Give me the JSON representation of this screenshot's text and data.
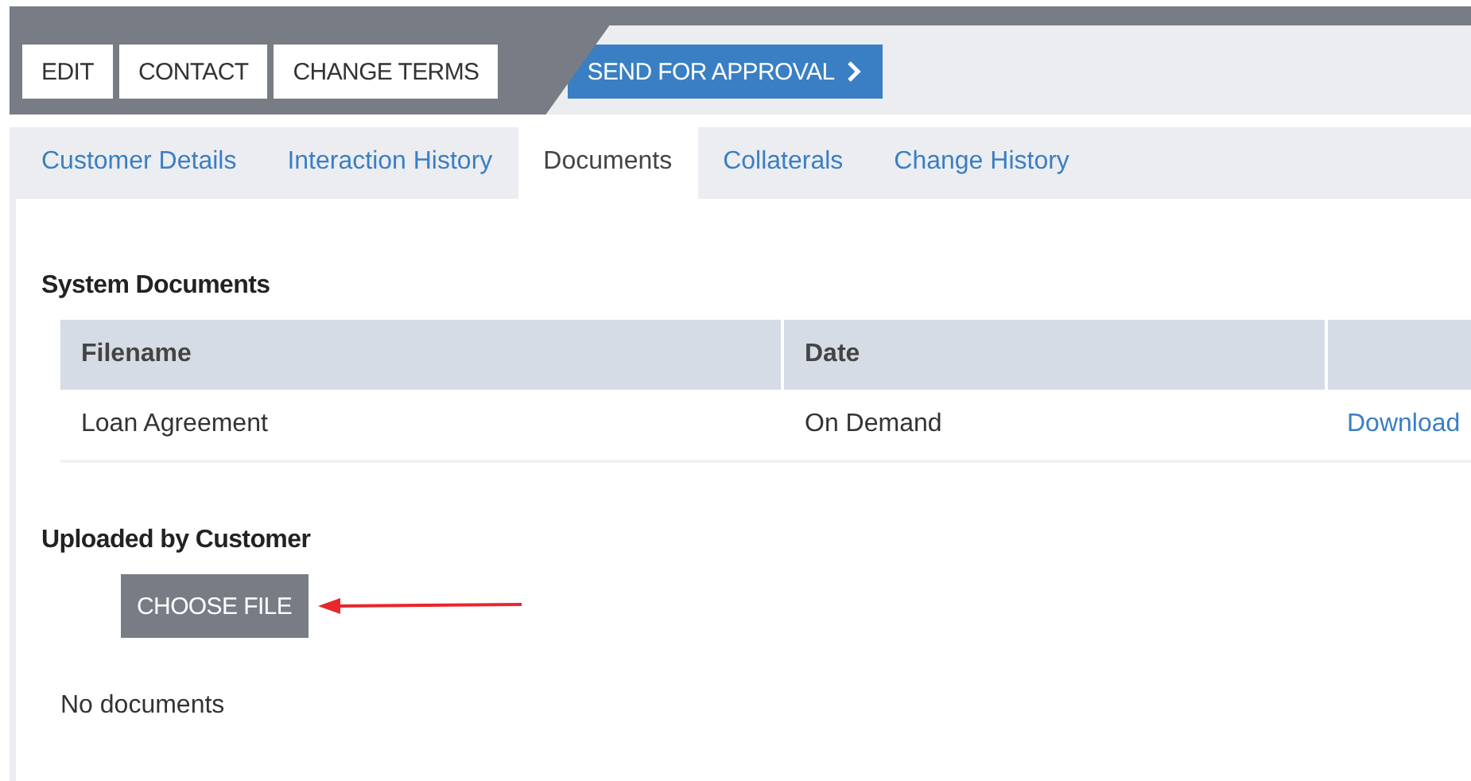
{
  "toolbar": {
    "actions": [
      {
        "label": "EDIT",
        "kind": "plain"
      },
      {
        "label": "CONTACT",
        "kind": "plain"
      },
      {
        "label": "CHANGE TERMS",
        "kind": "plain"
      },
      {
        "label": "SEND FOR APPROVAL",
        "kind": "primary"
      }
    ]
  },
  "tabs": [
    {
      "label": "Customer Details",
      "selected": false
    },
    {
      "label": "Interaction History",
      "selected": false
    },
    {
      "label": "Documents",
      "selected": true
    },
    {
      "label": "Collaterals",
      "selected": false
    },
    {
      "label": "Change History",
      "selected": false
    }
  ],
  "system_documents": {
    "title": "System Documents",
    "columns": [
      "Filename",
      "Date"
    ],
    "rows": [
      {
        "filename": "Loan Agreement",
        "date": "On Demand",
        "action": "Download"
      }
    ]
  },
  "uploaded": {
    "title": "Uploaded by Customer",
    "button": "CHOOSE FILE",
    "empty": "No documents"
  }
}
